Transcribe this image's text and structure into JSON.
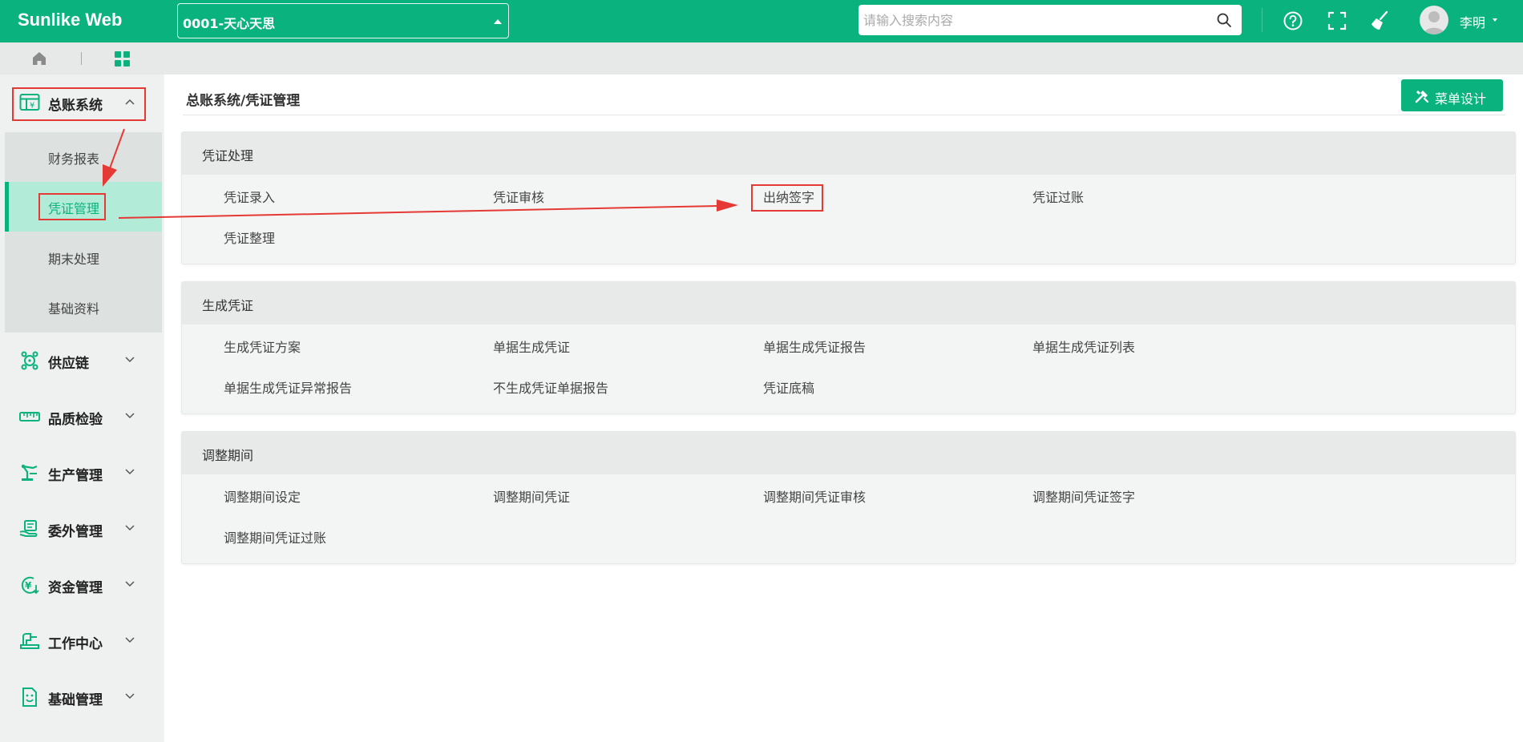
{
  "app": {
    "brand": "Sunlike Web"
  },
  "header": {
    "company": "0001-天心天思",
    "search_placeholder": "请输入搜索内容",
    "user_name": "李明"
  },
  "sidebar": {
    "groups": [
      {
        "label": "总账系统",
        "icon": "ledger-icon",
        "expanded": true
      },
      {
        "label": "供应链",
        "icon": "supply-chain-icon"
      },
      {
        "label": "品质检验",
        "icon": "ruler-icon"
      },
      {
        "label": "生产管理",
        "icon": "robot-arm-icon"
      },
      {
        "label": "委外管理",
        "icon": "outsourcing-icon"
      },
      {
        "label": "资金管理",
        "icon": "yen-icon"
      },
      {
        "label": "工作中心",
        "icon": "workbench-icon"
      },
      {
        "label": "基础管理",
        "icon": "document-icon"
      }
    ],
    "submenu": [
      {
        "label": "财务报表"
      },
      {
        "label": "凭证管理",
        "active": true
      },
      {
        "label": "期末处理"
      },
      {
        "label": "基础资料"
      }
    ]
  },
  "main": {
    "breadcrumb": "总账系统/凭证管理",
    "design_button": "菜单设计",
    "panels": [
      {
        "title": "凭证处理",
        "items": [
          "凭证录入",
          "凭证审核",
          "出纳签字",
          "凭证过账",
          "凭证整理"
        ]
      },
      {
        "title": "生成凭证",
        "items": [
          "生成凭证方案",
          "单据生成凭证",
          "单据生成凭证报告",
          "单据生成凭证列表",
          "单据生成凭证异常报告",
          "不生成凭证单据报告",
          "凭证底稿"
        ]
      },
      {
        "title": "调整期间",
        "items": [
          "调整期间设定",
          "调整期间凭证",
          "调整期间凭证审核",
          "调整期间凭证签字",
          "调整期间凭证过账"
        ]
      }
    ]
  },
  "colors": {
    "brand": "#0ab37d",
    "annotation": "#e53935"
  }
}
